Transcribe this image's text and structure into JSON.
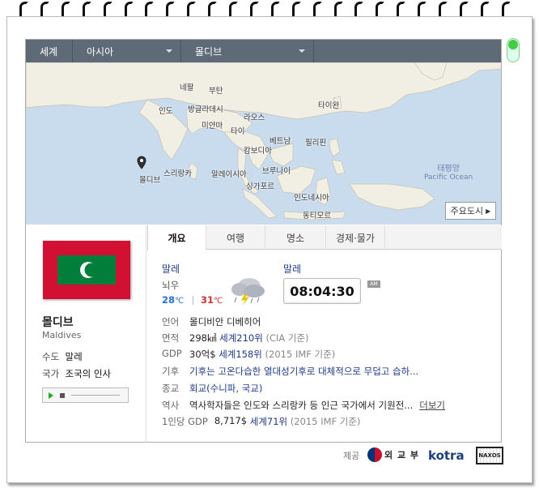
{
  "breadcrumb": {
    "level1": "세계",
    "level2": "아시아",
    "level3": "몰디브"
  },
  "map": {
    "country_labels": {
      "nepal": "네팔",
      "bhutan": "부탄",
      "india": "인도",
      "bangladesh": "방글라데시",
      "myanmar": "미얀마",
      "laos": "라오스",
      "thailand": "타이",
      "vietnam": "베트남",
      "cambodia": "캄보디아",
      "philippines": "필리핀",
      "taiwan": "타이완",
      "sri_lanka": "스리랑카",
      "maldives": "몰디브",
      "malaysia": "말레이시아",
      "brunei": "브루나이",
      "singapore": "싱가포르",
      "indonesia": "인도네시아",
      "east_timor": "동티모르"
    },
    "ocean_ko": "태평양",
    "ocean_en": "Pacific Ocean",
    "cities_button": "주요도시",
    "pin_icon": "location-pin-icon"
  },
  "country": {
    "name_ko": "몰디브",
    "name_en": "Maldives",
    "capital_label": "수도",
    "capital_value": "말레",
    "anthem_label": "국가",
    "anthem_value": "조국의 인사",
    "flag_colors": {
      "red": "#d21034",
      "green": "#007e3a",
      "white": "#ffffff"
    }
  },
  "tabs": [
    "개요",
    "여행",
    "명소",
    "경제·물가"
  ],
  "weather": {
    "city": "말레",
    "condition": "뇌우",
    "temp_low": "28",
    "temp_high": "31",
    "unit": "℃",
    "icon": "thunderstorm-cloud-icon"
  },
  "time": {
    "city": "말레",
    "clock": "08:04:30",
    "ampm": "AM"
  },
  "facts": {
    "language": {
      "label": "언어",
      "value": "몰디비안 디베히어"
    },
    "area": {
      "label": "면적",
      "value": "298㎢",
      "rank": "세계210위",
      "source": "(CIA 기준)"
    },
    "gdp": {
      "label": "GDP",
      "value": "30억$",
      "rank": "세계158위",
      "source": "(2015 IMF 기준)"
    },
    "climate": {
      "label": "기후",
      "value": "기후는 고온다습한 열대성기후로 대체적으로 무덥고 습하..."
    },
    "religion": {
      "label": "종교",
      "value": "회교(수니파, 국교)"
    },
    "history": {
      "label": "역사",
      "value": "역사학자들은 인도와 스리랑카 등 인근 국가에서 기원전...",
      "more": "더보기"
    },
    "gdp_per_capita": {
      "label": "1인당 GDP",
      "value": "8,717$",
      "rank": "세계71위",
      "source": "(2015 IMF 기준)"
    }
  },
  "footer": {
    "provider_label": "제공",
    "mofa": "외 교 부",
    "kotra": "kotra",
    "naxos": "NAXOS"
  }
}
